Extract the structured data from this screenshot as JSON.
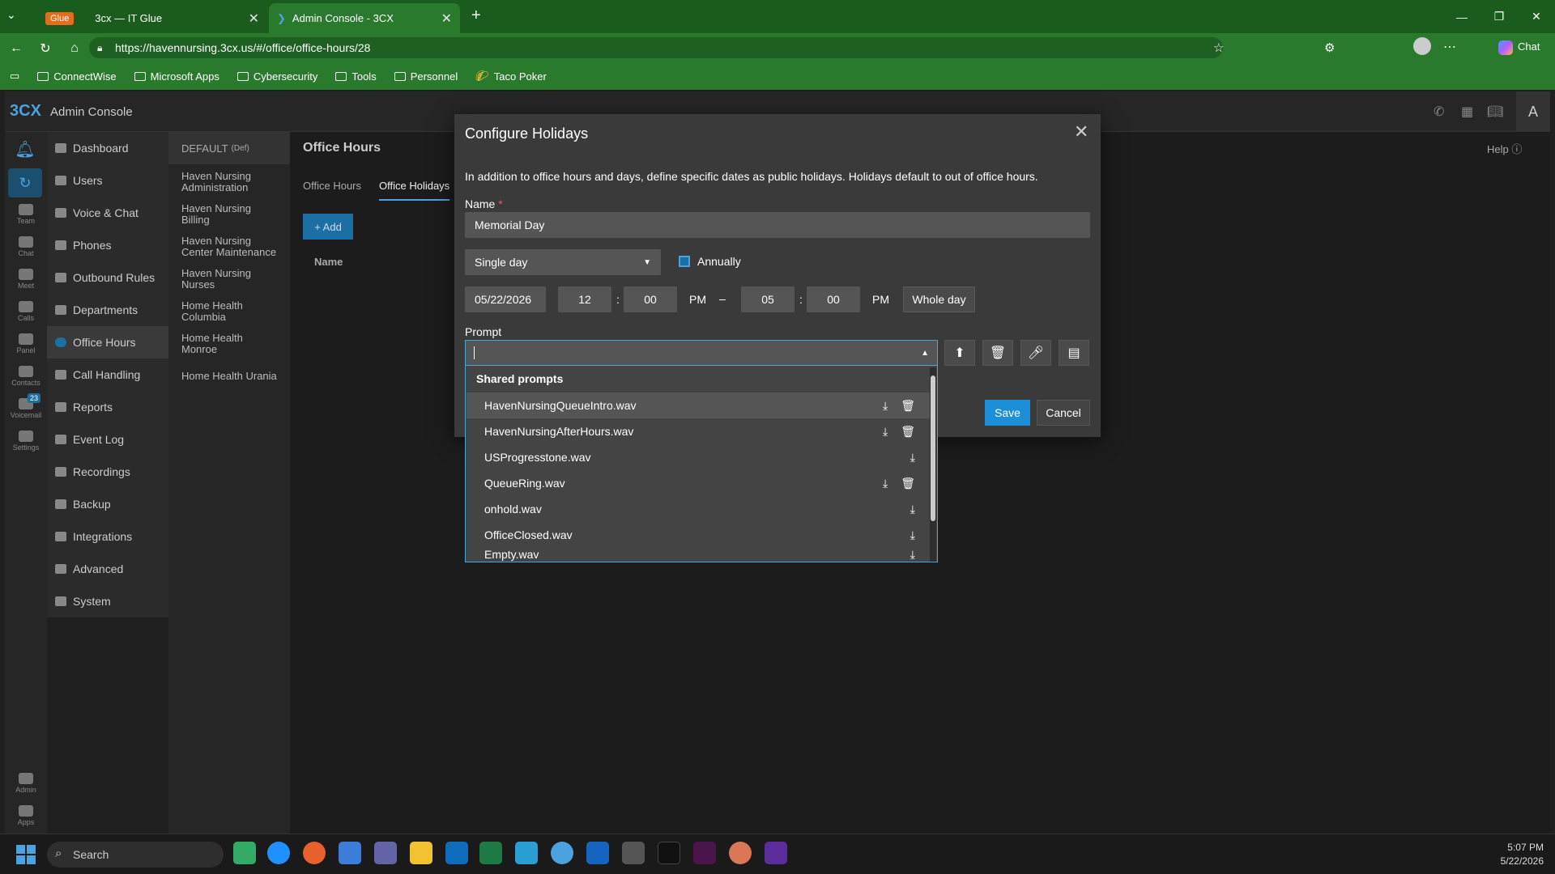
{
  "browser": {
    "tabs": [
      {
        "badge": "Glue",
        "title": "3cx — IT Glue"
      },
      {
        "title": "Admin Console - 3CX"
      }
    ],
    "url": "https://havennursing.3cx.us/#/office/office-hours/28",
    "bookmarks": [
      "ConnectWise",
      "Microsoft Apps",
      "Cybersecurity",
      "Tools",
      "Personnel",
      "Taco Poker"
    ],
    "chat_label": "Chat"
  },
  "app": {
    "logo": "3CX",
    "title": "Admin Console",
    "user_initial": "A",
    "help_label": "Help",
    "rail": [
      "Team",
      "Chat",
      "Meet",
      "Calls",
      "Panel",
      "Contacts",
      "Voicemail",
      "Settings",
      "Admin",
      "Apps"
    ],
    "voicemail_badge": "23",
    "nav": [
      "Dashboard",
      "Users",
      "Voice & Chat",
      "Phones",
      "Outbound Rules",
      "Departments",
      "Office Hours",
      "Call Handling",
      "Reports",
      "Event Log",
      "Recordings",
      "Backup",
      "Integrations",
      "Advanced",
      "System"
    ],
    "org_header": "DEFAULT",
    "org_header_tag": "(Def)",
    "orgs": [
      "Haven Nursing Administration",
      "Haven Nursing Billing",
      "Haven Nursing Center Maintenance",
      "Haven Nursing Nurses",
      "Home Health Columbia",
      "Home Health Monroe",
      "Home Health Urania"
    ],
    "page_title": "Office Hours",
    "tabs": [
      "Office Hours",
      "Office Holidays"
    ],
    "add_label": "+ Add",
    "col_name": "Name"
  },
  "modal": {
    "title": "Configure Holidays",
    "description": "In addition to office hours and days, define specific dates as public holidays. Holidays default to out of office hours.",
    "name_label": "Name",
    "required_mark": "*",
    "name_value": "Memorial Day",
    "type_value": "Single day",
    "annually_label": "Annually",
    "date_value": "05/22/2026",
    "start_hour": "12",
    "start_min": "00",
    "start_ampm": "PM",
    "dash": "–",
    "end_hour": "05",
    "end_min": "00",
    "end_ampm": "PM",
    "whole_day_label": "Whole day",
    "prompt_label": "Prompt",
    "save_label": "Save",
    "cancel_label": "Cancel",
    "dropdown_group": "Shared prompts",
    "prompts": [
      {
        "name": "HavenNursingQueueIntro.wav",
        "deletable": true
      },
      {
        "name": "HavenNursingAfterHours.wav",
        "deletable": true
      },
      {
        "name": "USProgresstone.wav",
        "deletable": false
      },
      {
        "name": "QueueRing.wav",
        "deletable": true
      },
      {
        "name": "onhold.wav",
        "deletable": false
      },
      {
        "name": "OfficeClosed.wav",
        "deletable": false
      },
      {
        "name": "Empty.wav",
        "deletable": false
      }
    ]
  },
  "taskbar": {
    "search_placeholder": "Search",
    "time": "5:07 PM",
    "date": "5/22/2026"
  }
}
